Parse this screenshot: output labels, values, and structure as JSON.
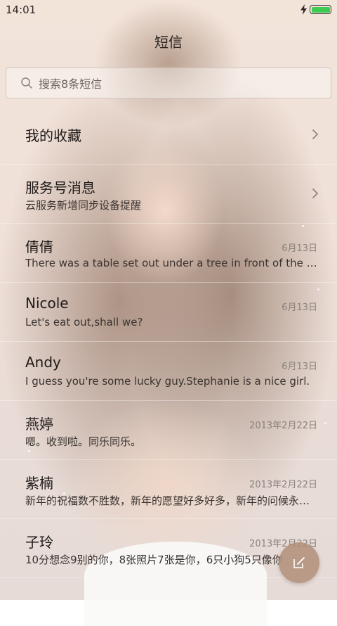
{
  "status_bar": {
    "time": "14:01",
    "battery_color": "#3ecb52"
  },
  "header": {
    "title": "短信"
  },
  "search": {
    "placeholder": "搜索8条短信"
  },
  "conversations": [
    {
      "name": "我的收藏",
      "preview": "",
      "date": "",
      "chevron": true
    },
    {
      "name": "服务号消息",
      "preview": "云服务新增同步设备提醒",
      "date": "",
      "chevron": true
    },
    {
      "name": "倩倩",
      "preview": "There was a table set out under a tree in front of the house, and the March Hare and the Hatter were having tea at it",
      "date": "6月13日",
      "chevron": false
    },
    {
      "name": "Nicole",
      "preview": "Let's eat out,shall we?",
      "date": "6月13日",
      "chevron": false
    },
    {
      "name": "Andy",
      "preview": "I guess you're some lucky guy.Stephanie is a nice girl.",
      "date": "6月13日",
      "chevron": false
    },
    {
      "name": "燕婷",
      "preview": "嗯。收到啦。同乐同乐。",
      "date": "2013年2月22日",
      "chevron": false
    },
    {
      "name": "紫楠",
      "preview": "新年的祝福数不胜数，新年的愿望好多好多，新年的问候永远不变",
      "date": "2013年2月22日",
      "chevron": false
    },
    {
      "name": "子玲",
      "preview": "10分想念9别的你，8张照片7张是你，6只小狗5只像你",
      "date": "2013年2月22日",
      "chevron": false
    }
  ],
  "compose": {
    "icon": "compose-icon"
  },
  "theme": {
    "accent": "#af8e78"
  }
}
